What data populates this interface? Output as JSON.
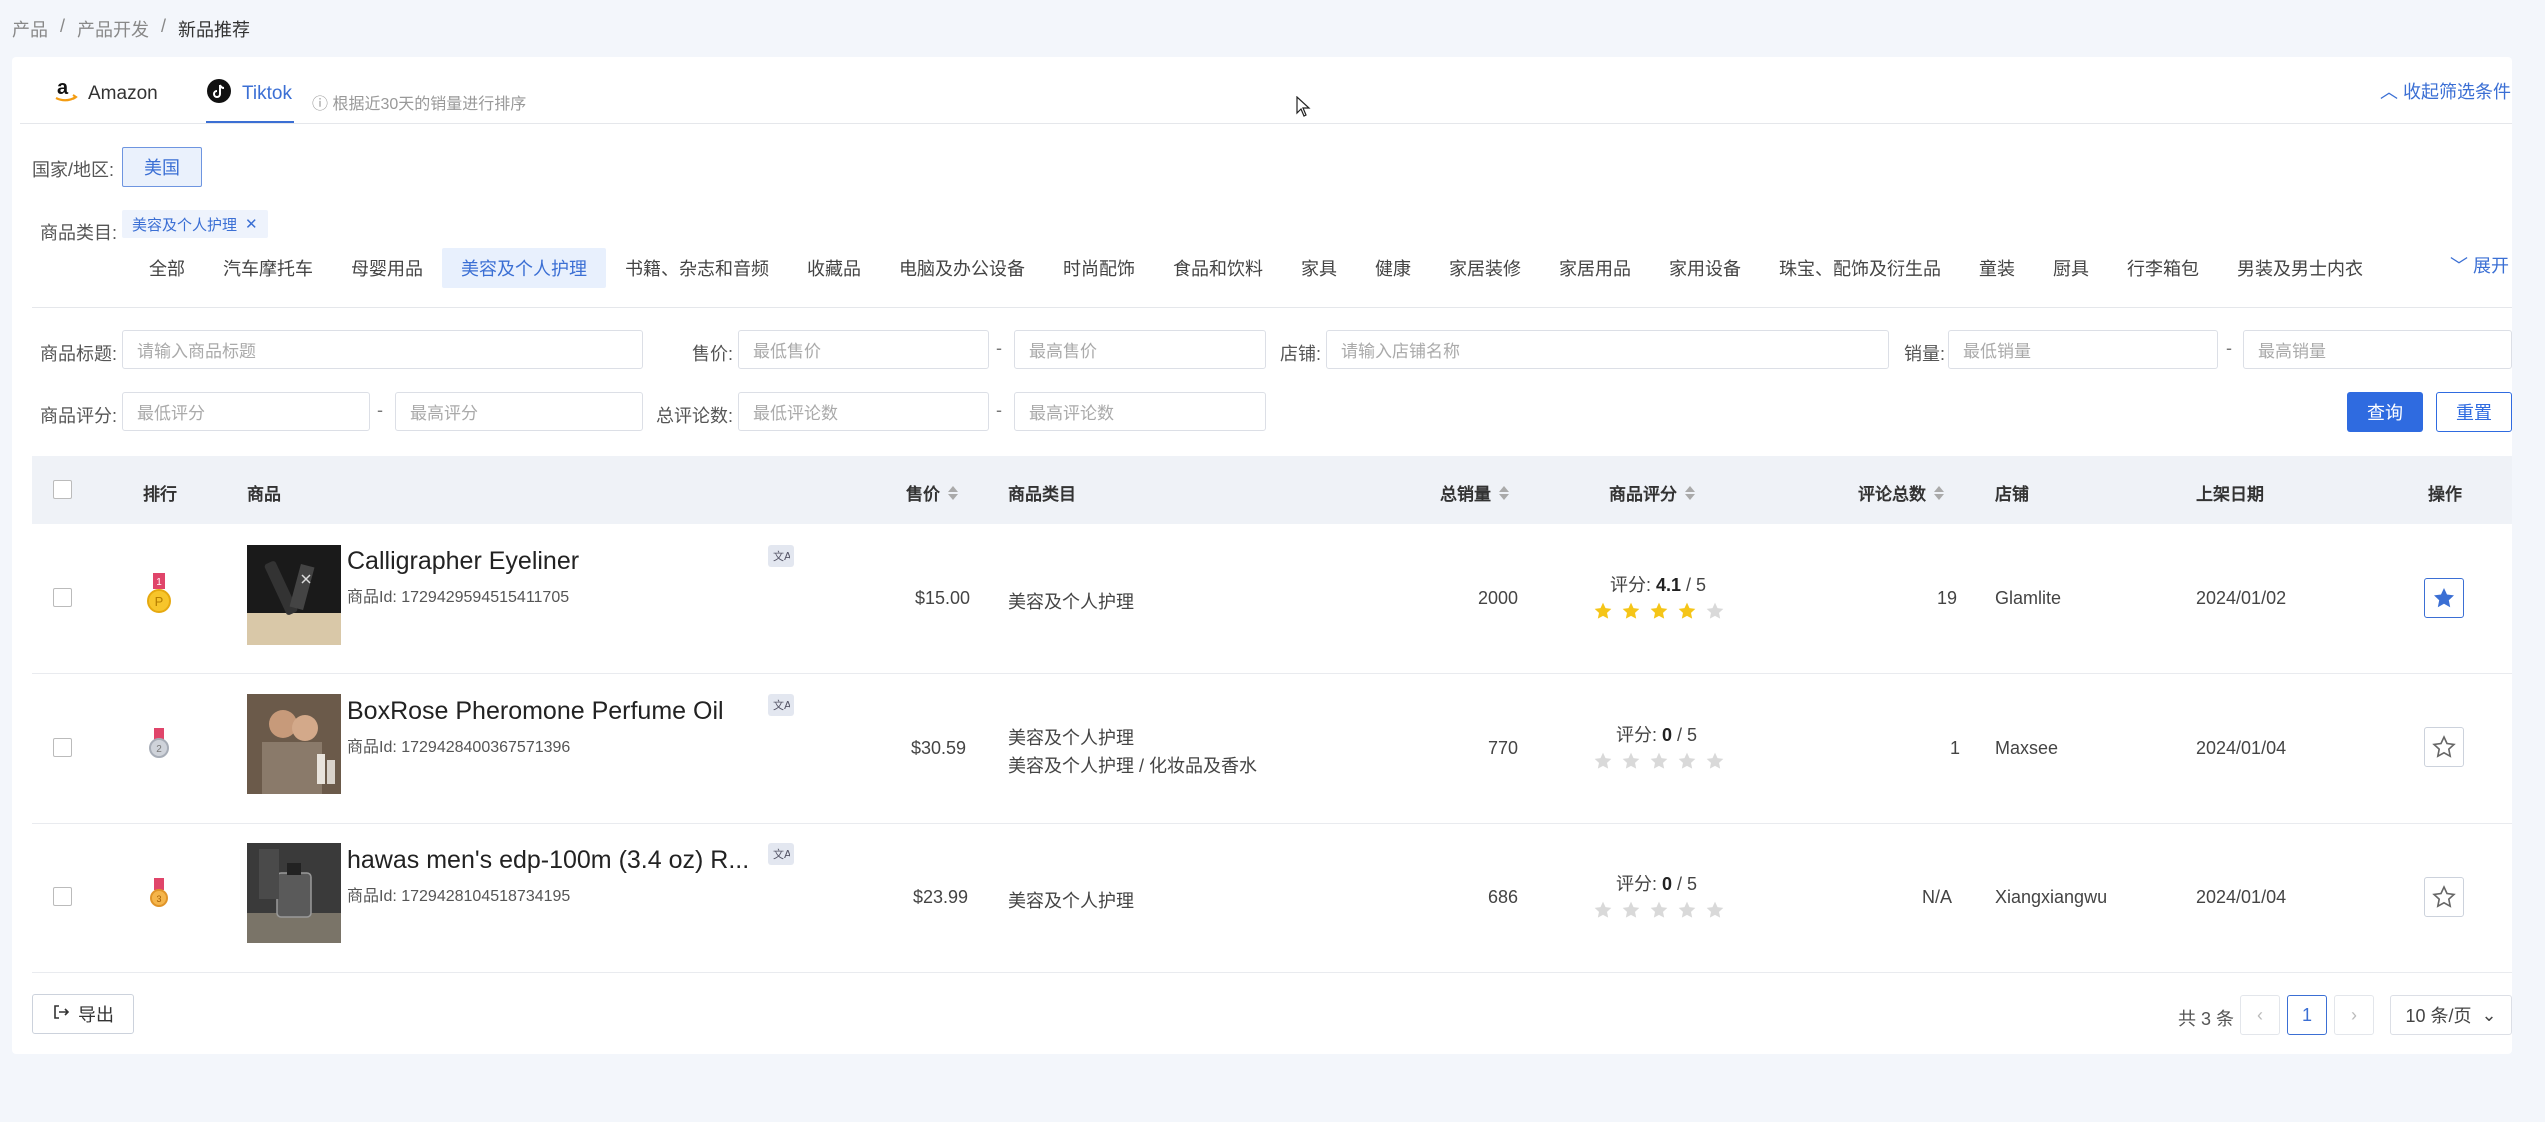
{
  "breadcrumb": {
    "item1": "产品",
    "item2": "产品开发",
    "current": "新品推荐"
  },
  "tabs": {
    "amazon": "Amazon",
    "tiktok": "Tiktok",
    "hint": "根据近30天的销量进行排序",
    "collapse": "收起筛选条件"
  },
  "filters": {
    "country_label": "国家/地区:",
    "country_value": "美国",
    "category_label": "商品类目:",
    "selected_chip": "美容及个人护理",
    "categories": [
      "全部",
      "汽车摩托车",
      "母婴用品",
      "美容及个人护理",
      "书籍、杂志和音频",
      "收藏品",
      "电脑及办公设备",
      "时尚配饰",
      "食品和饮料",
      "家具",
      "健康",
      "家居装修",
      "家居用品",
      "家用设备",
      "珠宝、配饰及衍生品",
      "童装",
      "厨具",
      "行李箱包",
      "男装及男士内衣"
    ],
    "expand": "展开",
    "title_label": "商品标题:",
    "title_placeholder": "请输入商品标题",
    "price_label": "售价:",
    "price_min": "最低售价",
    "price_max": "最高售价",
    "shop_label": "店铺:",
    "shop_placeholder": "请输入店铺名称",
    "sales_label": "销量:",
    "sales_min": "最低销量",
    "sales_max": "最高销量",
    "rating_label": "商品评分:",
    "rating_min": "最低评分",
    "rating_max": "最高评分",
    "reviews_label": "总评论数:",
    "reviews_min": "最低评论数",
    "reviews_max": "最高评论数",
    "dash": "-",
    "query": "查询",
    "reset": "重置"
  },
  "table": {
    "headers": {
      "rank": "排行",
      "product": "商品",
      "price": "售价",
      "category": "商品类目",
      "sales": "总销量",
      "rating": "商品评分",
      "reviews": "评论总数",
      "shop": "店铺",
      "date": "上架日期",
      "action": "操作"
    },
    "rows": [
      {
        "rank": 1,
        "name": "Calligrapher Eyeliner",
        "id": "商品Id: 1729429594515411705",
        "price": "$15.00",
        "category1": "美容及个人护理",
        "category2": "",
        "sales": "2000",
        "rating_label": "评分: ",
        "rating": "4.1",
        "rating_max": " / 5",
        "rating_value": 4,
        "reviews": "19",
        "shop": "Glamlite",
        "date": "2024/01/02",
        "favorited": true
      },
      {
        "rank": 2,
        "name": "BoxRose Pheromone Perfume Oil",
        "id": "商品Id: 1729428400367571396",
        "price": "$30.59",
        "category1": "美容及个人护理",
        "category2": "美容及个人护理 / 化妆品及香水",
        "sales": "770",
        "rating_label": "评分: ",
        "rating": "0",
        "rating_max": " / 5",
        "rating_value": 0,
        "reviews": "1",
        "shop": "Maxsee",
        "date": "2024/01/04",
        "favorited": false
      },
      {
        "rank": 3,
        "name": "hawas men's edp-100m (3.4 oz) R...",
        "id": "商品Id: 1729428104518734195",
        "price": "$23.99",
        "category1": "美容及个人护理",
        "category2": "",
        "sales": "686",
        "rating_label": "评分: ",
        "rating": "0",
        "rating_max": " / 5",
        "rating_value": 0,
        "reviews": "N/A",
        "shop": "Xiangxiangwu",
        "date": "2024/01/04",
        "favorited": false
      }
    ]
  },
  "footer": {
    "export": "导出",
    "total": "共 3 条",
    "page": "1",
    "page_size": "10 条/页"
  },
  "colors": {
    "accent": "#3b6fd4",
    "primary_button": "#2f6be0",
    "star_filled": "#f5c518",
    "star_empty": "#d9d9d9"
  }
}
